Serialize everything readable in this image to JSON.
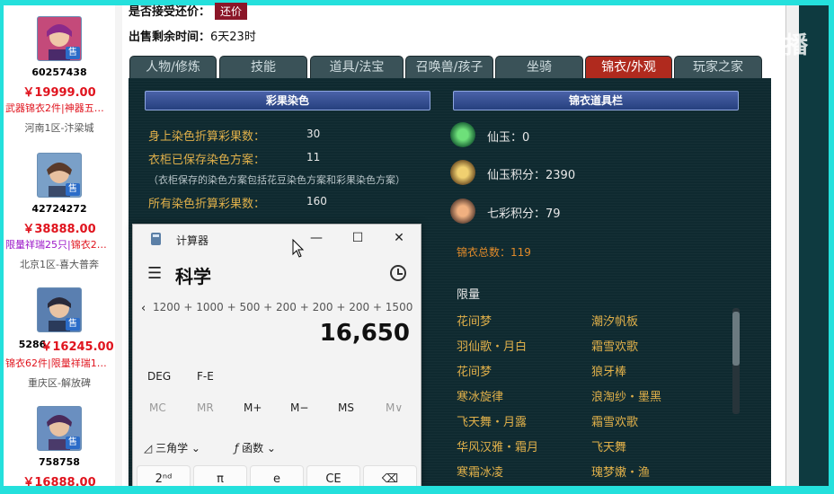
{
  "listings": [
    {
      "seller_id": "60257438",
      "price": "￥19999.00",
      "tags": [
        {
          "text": "武器锦衣2件|神器五…",
          "color": "red"
        }
      ],
      "server": "河南1区-汴梁城",
      "badge": "售",
      "avatar_color": "#c44a7a"
    },
    {
      "seller_id": "42724272",
      "price": "￥38888.00",
      "tags": [
        {
          "text": "限量祥瑞25只|",
          "color": "purple"
        },
        {
          "text": "锦衣2…",
          "color": "red"
        }
      ],
      "server": "北京1区-喜大普奔",
      "badge": "售",
      "avatar_color": "#6b4a3a"
    },
    {
      "seller_id": "5286",
      "price": "￥16245.00",
      "tags": [
        {
          "text": "锦衣62件|限量祥瑞1…",
          "color": "red"
        }
      ],
      "server": "重庆区-解放碑",
      "badge": "售",
      "avatar_color": "#3b4a6a"
    },
    {
      "seller_id": "758758",
      "price": "￥16888.00",
      "tags": [],
      "server": "",
      "badge": "售",
      "avatar_color": "#5a3a6a"
    }
  ],
  "main": {
    "counter_offer_label": "是否接受还价：",
    "counter_offer_button": "还价",
    "time_left_label": "出售剩余时间：",
    "time_left_value": "6天23时"
  },
  "tabs": [
    {
      "label": "人物/修炼",
      "active": false
    },
    {
      "label": "技能",
      "active": false
    },
    {
      "label": "道具/法宝",
      "active": false
    },
    {
      "label": "召唤兽/孩子",
      "active": false
    },
    {
      "label": "坐骑",
      "active": false
    },
    {
      "label": "锦衣/外观",
      "active": true
    },
    {
      "label": "玩家之家",
      "active": false
    }
  ],
  "dye": {
    "header": "彩果染色",
    "rows": [
      {
        "label": "身上染色折算彩果数：",
        "value": "30"
      },
      {
        "label": "衣柜已保存染色方案：",
        "value": "11"
      }
    ],
    "note": "（衣柜保存的染色方案包括花豆染色方案和彩果染色方案）",
    "total_label": "所有染色折算彩果数：",
    "total_value": "160"
  },
  "wardrobe": {
    "header": "锦衣道具栏",
    "currencies": [
      {
        "text": "仙玉：0",
        "icon": "jade-icon",
        "color": "#2fae4a"
      },
      {
        "text": "仙玉积分：2390",
        "icon": "jade-points-icon",
        "color": "#d6a23a"
      },
      {
        "text": "七彩积分：79",
        "icon": "rainbow-points-icon",
        "color": "#c58a4a"
      }
    ],
    "total": "锦衣总数：119",
    "limited_label": "限量",
    "items_left": [
      "花间梦",
      "羽仙歌・月白",
      "花间梦",
      "寒冰旋律",
      "飞天舞・月露",
      "华风汉雅・霜月",
      "寒霜冰凌"
    ],
    "items_right": [
      "潮汐帆板",
      "霜雪欢歌",
      "狼牙棒",
      "浪淘纱・墨黑",
      "霜雪欢歌",
      "飞天舞",
      "瑰梦嫩・渔"
    ]
  },
  "watermark": "CC直播",
  "calculator": {
    "title": "计算器",
    "mode": "科学",
    "expression": "1200 + 1000 + 500 + 200 + 200 + 200 + 1500 +",
    "display": "16,650",
    "angle_unit": "DEG",
    "fe_label": "F-E",
    "memory_keys": [
      {
        "label": "MC",
        "enabled": false
      },
      {
        "label": "MR",
        "enabled": false
      },
      {
        "label": "M+",
        "enabled": true
      },
      {
        "label": "M−",
        "enabled": true
      },
      {
        "label": "MS",
        "enabled": true
      },
      {
        "label": "M∨",
        "enabled": false
      }
    ],
    "trig_label": "三角学",
    "func_label": "函数",
    "keys": [
      "2ⁿᵈ",
      "π",
      "e",
      "CE",
      "⌫"
    ],
    "minimize": "—",
    "maximize": "☐",
    "close": "✕"
  }
}
